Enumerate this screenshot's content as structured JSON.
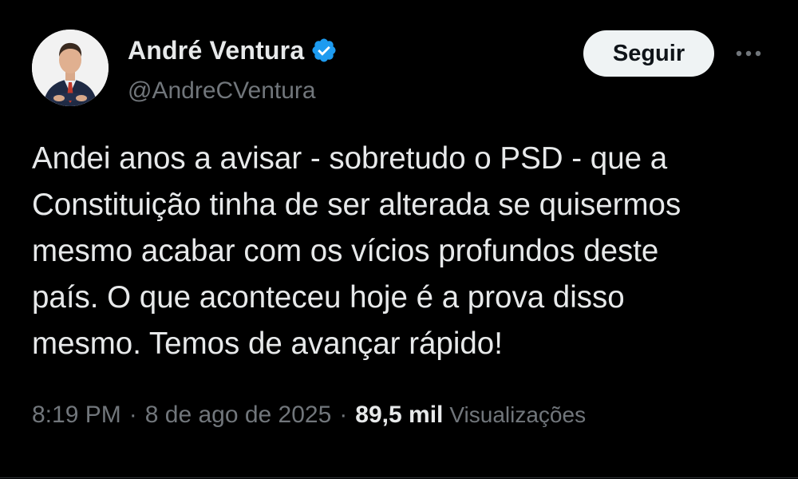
{
  "author": {
    "display_name": "André Ventura",
    "handle": "@AndreCVentura",
    "verified": true,
    "verified_color": "#1d9bf0"
  },
  "actions": {
    "follow_label": "Seguir",
    "more_icon": "more-horizontal-icon"
  },
  "tweet": {
    "text": "Andei anos a avisar - sobretudo o PSD - que a\nConstituição tinha de ser alterada se quisermos\nmesmo acabar com os vícios profundos deste\npaís. O que aconteceu hoje é a prova disso\nmesmo. Temos de avançar rápido!"
  },
  "meta": {
    "time": "8:19 PM",
    "separator": "·",
    "date": "8 de ago de 2025",
    "views_count": "89,5 mil",
    "views_label": "Visualizações"
  },
  "colors": {
    "background": "#000000",
    "primary_text": "#e7e9ea",
    "secondary_text": "#71767b",
    "follow_bg": "#eff3f4"
  }
}
